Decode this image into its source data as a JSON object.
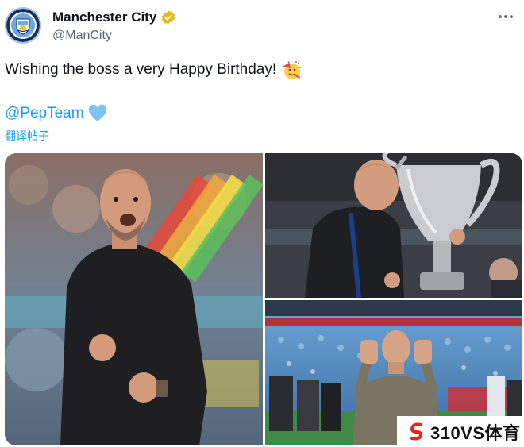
{
  "account": {
    "display_name": "Manchester City",
    "handle": "@ManCity",
    "avatar_icon": "man-city-crest-icon",
    "verified_icon": "gold-verified-badge-icon",
    "more_icon": "more-options-icon"
  },
  "tweet": {
    "text": "Wishing the boss a very Happy Birthday!",
    "emoji_icon": "party-face-emoji-icon",
    "mention": "@PepTeam",
    "heart_icon": "blue-heart-icon",
    "translate_label": "翻译帖子"
  },
  "media": {
    "photos": [
      {
        "icon": "photo-celebration-fist-pump"
      },
      {
        "icon": "photo-kissing-trophy"
      },
      {
        "icon": "photo-stadium-hands-gesture"
      }
    ]
  },
  "watermark": {
    "text": "310VS体育",
    "icon": "s-logo-icon"
  },
  "colors": {
    "link": "#1d9bf0",
    "secondary_text": "#536471",
    "verified_gold": "#e2b719"
  }
}
